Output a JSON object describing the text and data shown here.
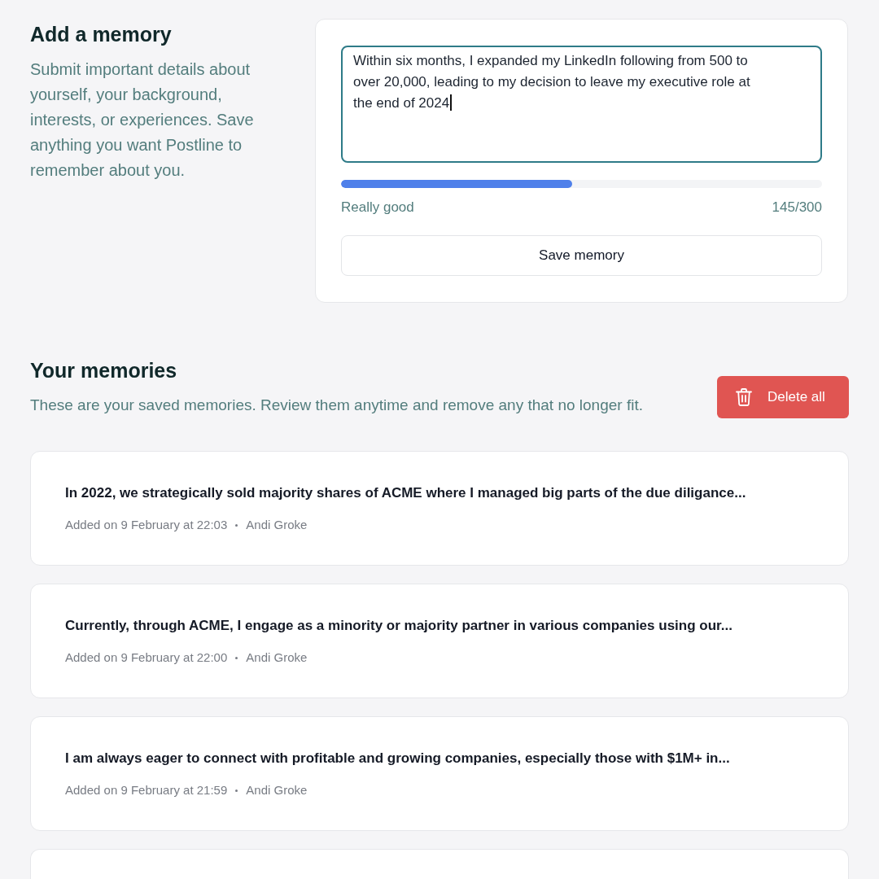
{
  "add_memory": {
    "title": "Add a memory",
    "description": "Submit important details about yourself, your background, interests, or experiences. Save anything you want Postline to remember about you.",
    "textarea": {
      "value": "Within six months, I expanded my LinkedIn following from 500 to over 20,000, leading to my decision to leave my executive role at the end of 2024",
      "focused": true
    },
    "quality": {
      "level": 0.48,
      "label": "Really good",
      "count": "145/300"
    },
    "save_button": "Save memory"
  },
  "memories_section": {
    "title": "Your memories",
    "description": "These are your saved memories. Review them anytime and remove any that no longer fit.",
    "delete_button": "Delete all",
    "memories": [
      {
        "text": "In 2022, we strategically sold majority shares of ACME where I managed big parts of the due diligance...",
        "date": "Added on 9 February at 22:03",
        "author": "Andi Groke"
      },
      {
        "text": "Currently, through ACME, I engage as a minority or majority partner in various companies using our...",
        "date": "Added on 9 February at 22:00",
        "author": "Andi Groke"
      },
      {
        "text": "I am always eager to connect with profitable and growing companies, especially those with $1M+ in...",
        "date": "Added on 9 February at 21:59",
        "author": "Andi Groke"
      }
    ]
  }
}
